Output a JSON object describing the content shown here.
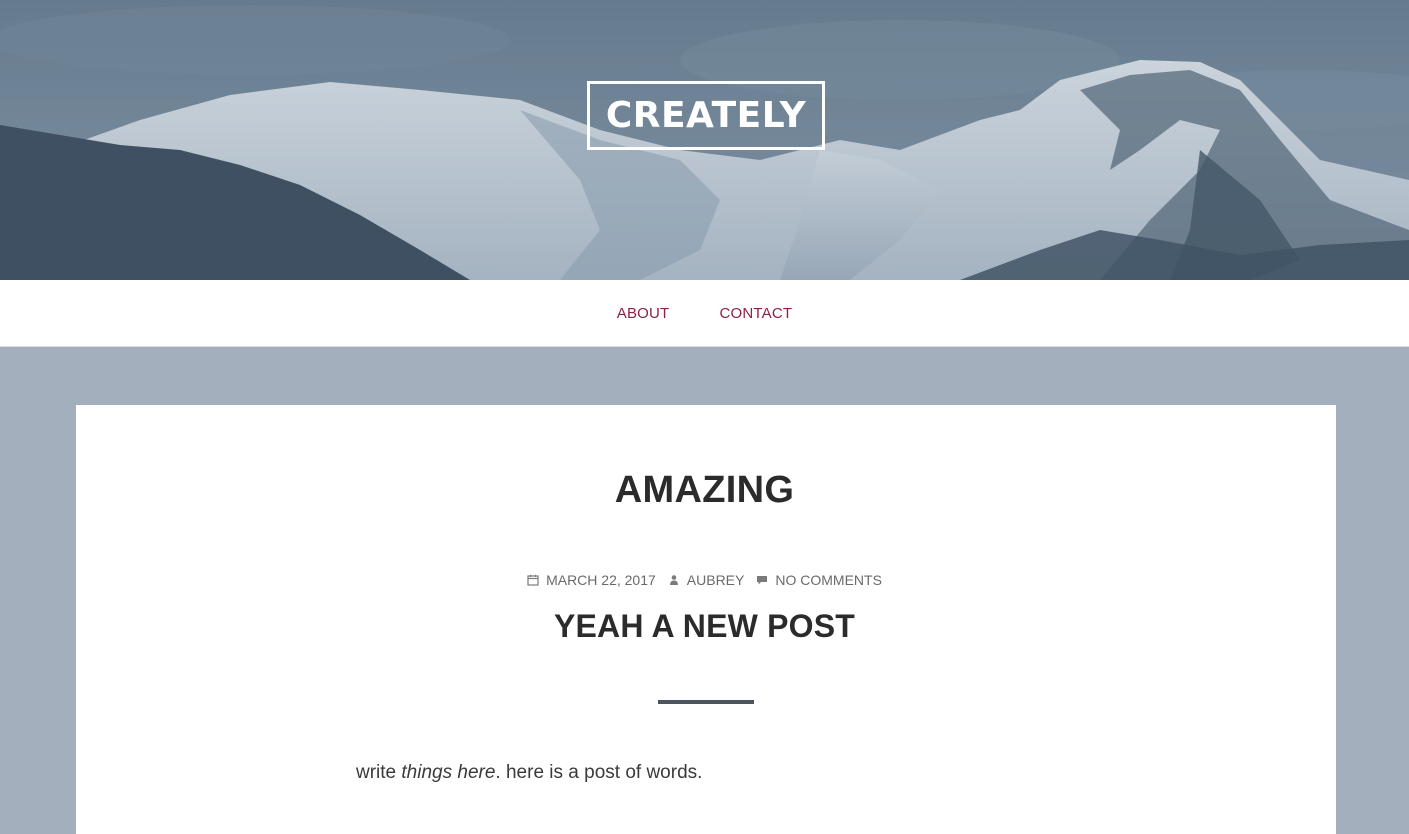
{
  "site": {
    "title": "CREATELY"
  },
  "nav": {
    "items": [
      {
        "label": "ABOUT"
      },
      {
        "label": "CONTACT"
      }
    ]
  },
  "page": {
    "heading": "AMAZING"
  },
  "post": {
    "date": "MARCH 22, 2017",
    "author": "AUBREY",
    "comments": "NO COMMENTS",
    "title": "YEAH A NEW POST",
    "body_before": "write ",
    "body_emphasis": "things here",
    "body_after": ". here is a post of words."
  },
  "colors": {
    "nav_link": "#8a2244",
    "page_background": "#a3afbd",
    "divider": "#4b5560"
  },
  "icons": {
    "date": "calendar-icon",
    "author": "user-icon",
    "comments": "comment-icon"
  }
}
